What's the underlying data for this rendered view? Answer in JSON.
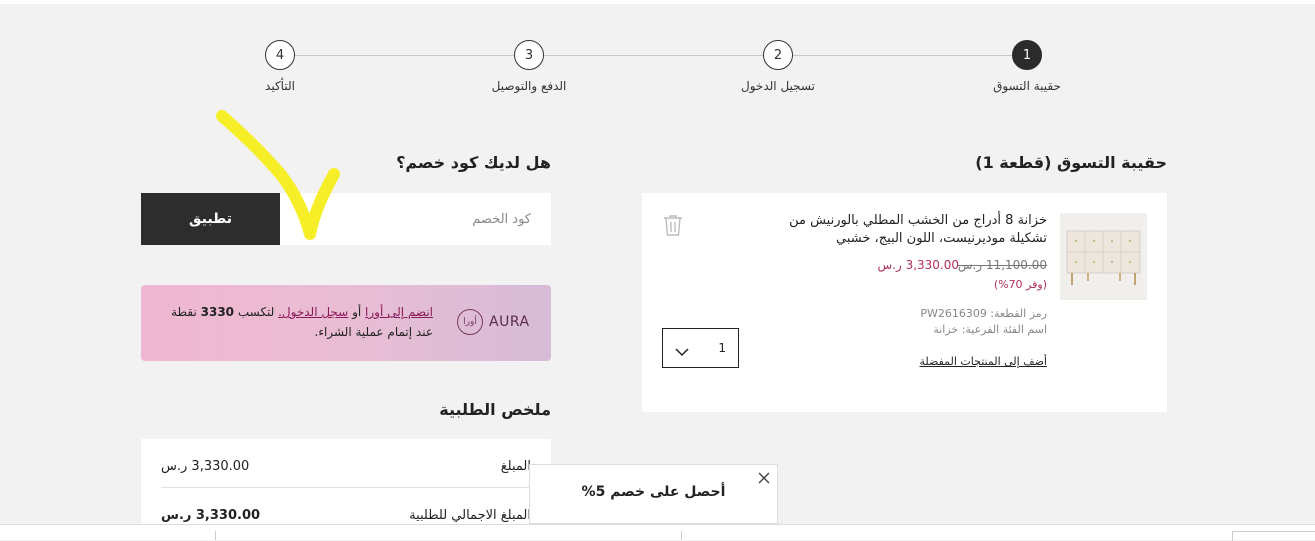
{
  "stepper": {
    "steps": [
      {
        "number": "1",
        "label": "حقيبة التسوق",
        "active": true
      },
      {
        "number": "2",
        "label": "تسجيل الدخول",
        "active": false
      },
      {
        "number": "3",
        "label": "الدفع والتوصيل",
        "active": false
      },
      {
        "number": "4",
        "label": "التأكيد",
        "active": false
      }
    ]
  },
  "cart": {
    "title": "حقيبة التسوق (قطعة 1)",
    "item": {
      "name": "خزانة 8 أدراج من الخشب المطلي بالورنيش من تشكيلة موديرنيست، اللون البيج، خشبي",
      "old_price": "11,100.00 ر.س",
      "new_price": "3,330.00 ر.س",
      "saving": "(وفر 70%)",
      "sku": "رمز القطعة: PW2616309",
      "subcategory": "اسم الفئة الفرعية: خزانة",
      "wishlist_link": "أضف إلى المنتجات المفضلة",
      "quantity": "1",
      "icons": {
        "delete": "trash-icon",
        "dropdown": "chevron-down-icon"
      }
    }
  },
  "coupon": {
    "title": "هل لديك كود خصم؟",
    "placeholder": "كود الخصم",
    "apply_label": "تطبيق"
  },
  "aura": {
    "logo_text": "AURA",
    "logo_arabic": "أورا",
    "join_link": "انضم إلى أورا",
    "or": "أو",
    "login_link": "سجل الدخول.",
    "earn": "لتكسب",
    "points": "3330",
    "rest": "نقطة عند إتمام عملية الشراء."
  },
  "summary": {
    "title": "ملخص الطلبية",
    "rows": [
      {
        "label": "المبلغ",
        "value": "3,330.00 ر.س"
      },
      {
        "label": "المبلغ الاجمالي للطلبية",
        "value": "3,330.00 ر.س"
      }
    ]
  },
  "promo_popup": {
    "text": "أحصل على خصم 5%"
  },
  "colors": {
    "accent_price": "#b0325d",
    "dark_button": "#2d2d2d",
    "annotation": "#f5ee1c"
  }
}
